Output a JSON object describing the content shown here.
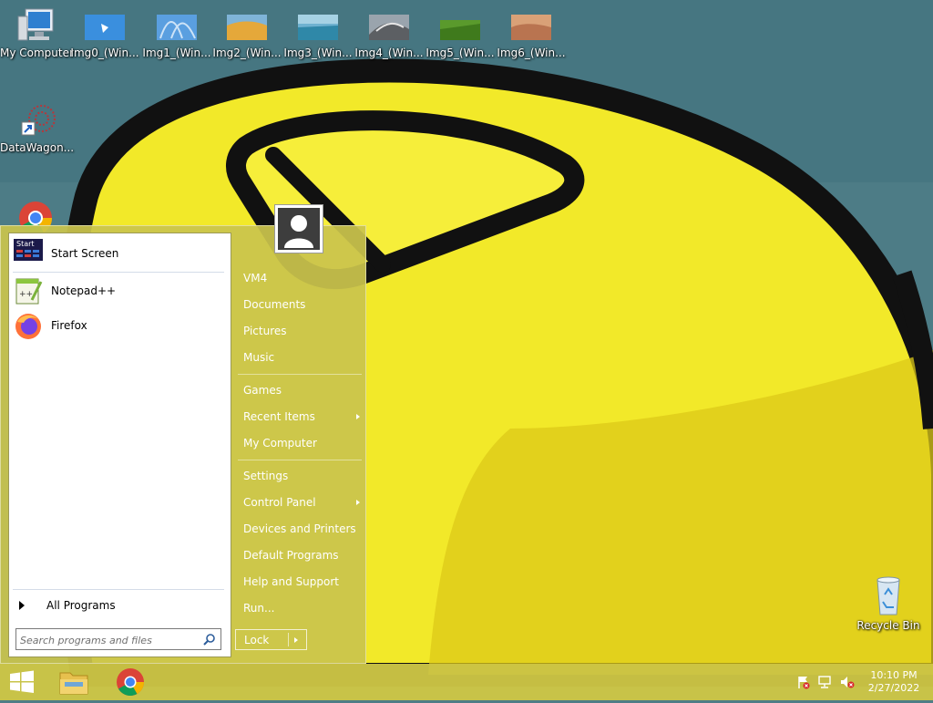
{
  "desktop": {
    "icons": [
      {
        "label": "My Computer",
        "icon": "computer-icon"
      },
      {
        "label": "Img0_(Win...",
        "icon": "image-thumbnail-icon"
      },
      {
        "label": "Img1_(Win...",
        "icon": "image-thumbnail-icon"
      },
      {
        "label": "Img2_(Win...",
        "icon": "image-thumbnail-icon"
      },
      {
        "label": "Img3_(Win...",
        "icon": "image-thumbnail-icon"
      },
      {
        "label": "Img4_(Win...",
        "icon": "image-thumbnail-icon"
      },
      {
        "label": "Img5_(Win...",
        "icon": "image-thumbnail-icon"
      },
      {
        "label": "Img6_(Win...",
        "icon": "image-thumbnail-icon"
      },
      {
        "label": "DataWagon...",
        "icon": "shortcut-icon"
      },
      {
        "label": "Recycle Bin",
        "icon": "recycle-bin-icon"
      }
    ]
  },
  "start_menu": {
    "pinned": [
      {
        "label": "Start Screen",
        "icon": "start-screen-icon"
      },
      {
        "label": "Notepad++",
        "icon": "notepadpp-icon"
      },
      {
        "label": "Firefox",
        "icon": "firefox-icon"
      }
    ],
    "all_programs": "All Programs",
    "search_placeholder": "Search programs and files",
    "start_badge": "Start",
    "places": [
      {
        "label": "VM4"
      },
      {
        "label": "Documents"
      },
      {
        "label": "Pictures"
      },
      {
        "label": "Music"
      },
      {
        "label": "Games"
      },
      {
        "label": "Recent Items",
        "submenu": true
      },
      {
        "label": "My Computer"
      },
      {
        "label": "Settings"
      },
      {
        "label": "Control Panel",
        "submenu": true
      },
      {
        "label": "Devices and Printers"
      },
      {
        "label": "Default Programs"
      },
      {
        "label": "Help and Support"
      },
      {
        "label": "Run..."
      }
    ],
    "lock_label": "Lock"
  },
  "taskbar": {
    "buttons": [
      {
        "icon": "windows-start-icon"
      },
      {
        "icon": "file-explorer-icon"
      },
      {
        "icon": "chrome-icon"
      }
    ],
    "tray": [
      {
        "icon": "action-center-flag-icon"
      },
      {
        "icon": "network-icon"
      },
      {
        "icon": "volume-muted-icon"
      }
    ],
    "time": "10:10 PM",
    "date": "2/27/2022"
  },
  "colors": {
    "wallpaper_teal": "#4f7d86",
    "mouse_yellow": "#f3ea2a",
    "start_menu_bg": "#cac44c",
    "taskbar_bg": "#cdc646"
  }
}
